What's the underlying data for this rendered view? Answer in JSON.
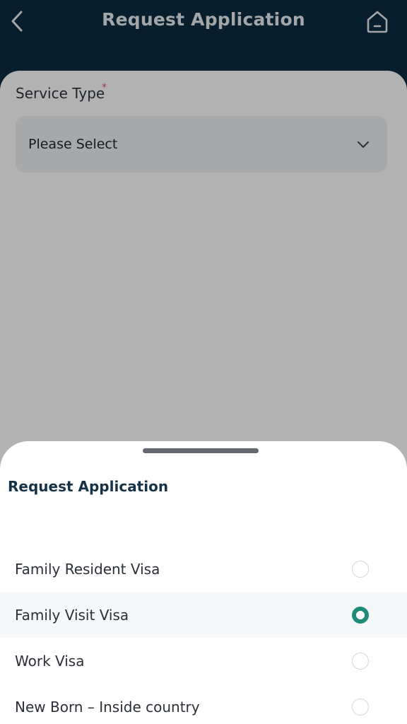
{
  "header": {
    "title": "Request Application",
    "back_icon": "chevron-left-icon",
    "home_icon": "home-icon"
  },
  "form": {
    "service_type_label": "Service Type",
    "required_marker": "*",
    "select_placeholder": "Please Select"
  },
  "sheet": {
    "title": "Request Application",
    "options": [
      {
        "label": "Family Resident Visa",
        "selected": false
      },
      {
        "label": "Family Visit Visa",
        "selected": true
      },
      {
        "label": "Work Visa",
        "selected": false
      },
      {
        "label": "New Born – Inside country",
        "selected": false
      }
    ]
  },
  "colors": {
    "header_bg": "#0b2b42",
    "accent": "#1f8c7a",
    "required": "#e05260"
  }
}
